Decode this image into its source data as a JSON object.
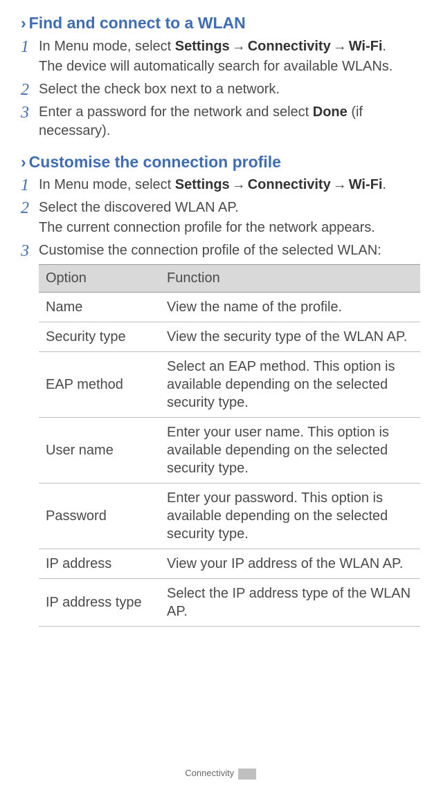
{
  "section1": {
    "title": "Find and connect to a WLAN",
    "steps": [
      {
        "num": "1",
        "pre": "In Menu mode, select ",
        "b1": "Settings",
        "mid1": " → ",
        "b2": "Connectivity",
        "mid2": " → ",
        "b3": "Wi-Fi",
        "post": ".",
        "sub": "The device will automatically search for available WLANs."
      },
      {
        "num": "2",
        "text": "Select the check box next to a network."
      },
      {
        "num": "3",
        "pre": "Enter a password for the network and select ",
        "b1": "Done",
        "post": " (if necessary)."
      }
    ]
  },
  "section2": {
    "title": "Customise the connection profile",
    "steps": [
      {
        "num": "1",
        "pre": "In Menu mode, select ",
        "b1": "Settings",
        "mid1": " → ",
        "b2": "Connectivity",
        "mid2": " → ",
        "b3": "Wi-Fi",
        "post": "."
      },
      {
        "num": "2",
        "text": "Select the discovered WLAN AP.",
        "sub": "The current connection profile for the network appears."
      },
      {
        "num": "3",
        "text": "Customise the connection profile of the selected WLAN:"
      }
    ]
  },
  "table": {
    "head": {
      "c1": "Option",
      "c2": "Function"
    },
    "rows": [
      {
        "c1": "Name",
        "c2": "View the name of the profile."
      },
      {
        "c1": "Security type",
        "c2": "View the security type of the WLAN AP."
      },
      {
        "c1": "EAP method",
        "c2": "Select an EAP method. This option is available depending on the selected security type."
      },
      {
        "c1": "User name",
        "c2": "Enter your user name. This option is available depending on the selected security type."
      },
      {
        "c1": "Password",
        "c2": "Enter your password. This option is available depending on the selected security type."
      },
      {
        "c1": "IP address",
        "c2": "View your IP address of the WLAN AP."
      },
      {
        "c1": "IP address type",
        "c2": "Select the IP address type of the WLAN AP."
      }
    ]
  },
  "footer": {
    "label": "Connectivity"
  }
}
